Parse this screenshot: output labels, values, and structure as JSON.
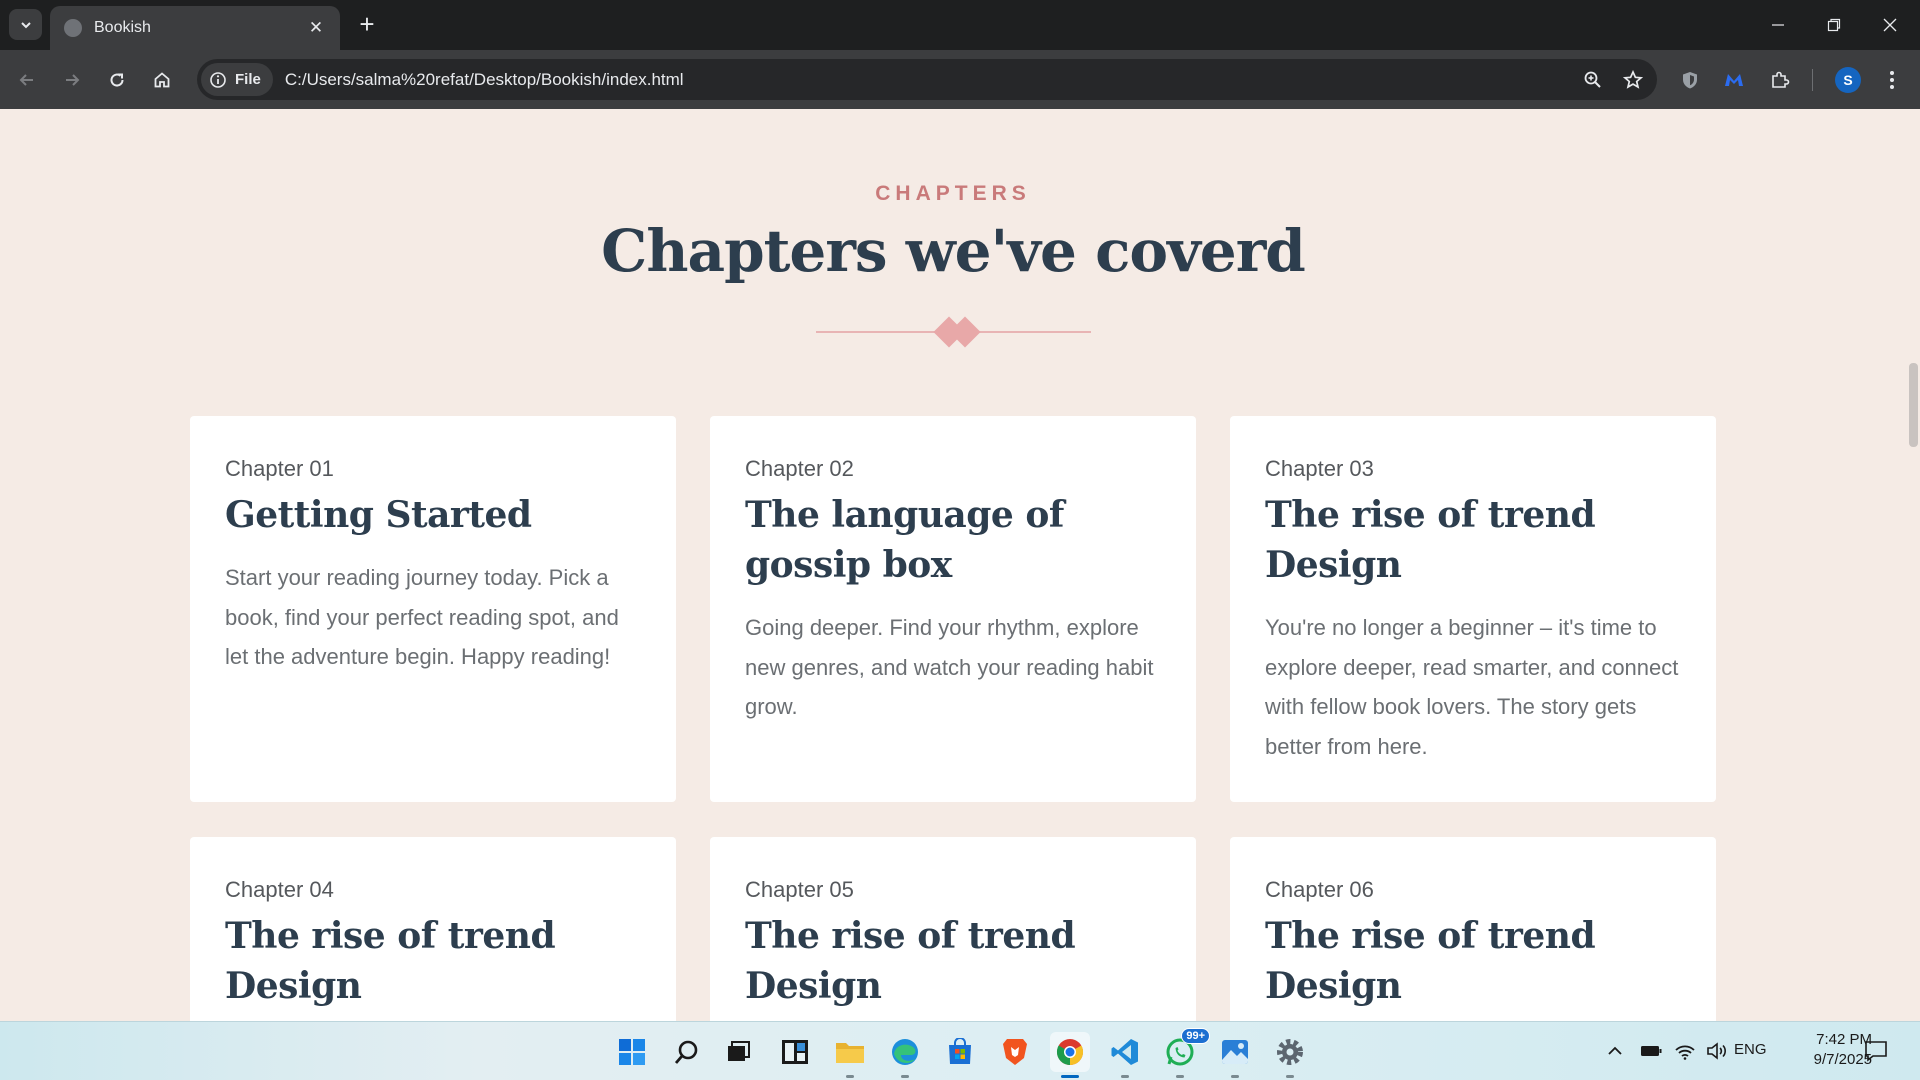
{
  "browser": {
    "tab_title": "Bookish",
    "site_chip_label": "File",
    "url": "C:/Users/salma%20refat/Desktop/Bookish/index.html",
    "profile_initial": "S"
  },
  "section": {
    "eyebrow": "CHAPTERS",
    "title": "Chapters we've coverd"
  },
  "chapters": [
    {
      "num": "Chapter 01",
      "title": "Getting Started",
      "desc": "Start your reading journey today. Pick a book, find your perfect reading spot, and let the adventure begin. Happy reading!"
    },
    {
      "num": "Chapter 02",
      "title": "The language of gossip box",
      "desc": "Going deeper. Find your rhythm, explore new genres, and watch your reading habit grow."
    },
    {
      "num": "Chapter 03",
      "title": "The rise of trend Design",
      "desc": "You're no longer a beginner – it's time to explore deeper, read smarter, and connect with fellow book lovers. The story gets better from here."
    },
    {
      "num": "Chapter 04",
      "title": "The rise of trend Design",
      "desc": ""
    },
    {
      "num": "Chapter 05",
      "title": "The rise of trend Design",
      "desc": ""
    },
    {
      "num": "Chapter 06",
      "title": "The rise of trend Design",
      "desc": ""
    }
  ],
  "taskbar": {
    "whatsapp_badge": "99+",
    "language": "ENG",
    "time": "7:42 PM",
    "date": "9/7/2025"
  },
  "colors": {
    "page_bg": "#f5ebe5",
    "accent": "#c97a7a",
    "heading": "#2d3e4e",
    "chrome_dark": "#1e1f20"
  }
}
